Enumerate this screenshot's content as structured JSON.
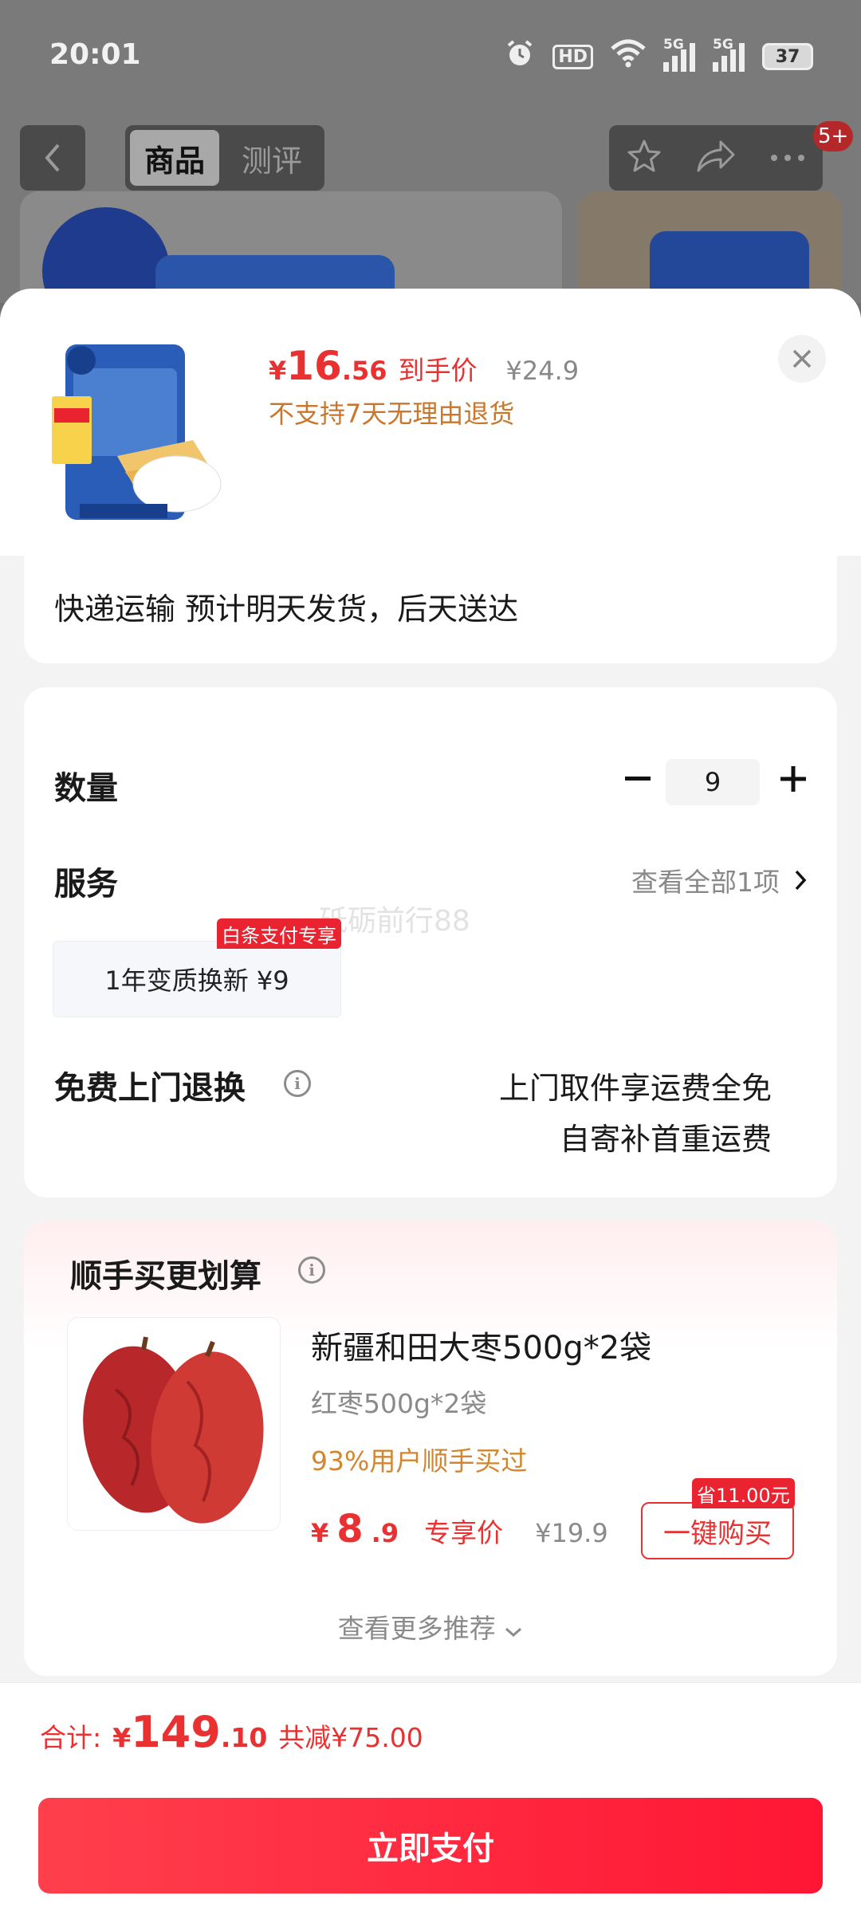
{
  "status_bar": {
    "time": "20:01",
    "hd_label": "HD",
    "signal_1": "5G",
    "signal_2": "5G",
    "battery": "37"
  },
  "nav": {
    "tabs": [
      "商品",
      "测评"
    ],
    "active_tab": "商品",
    "badge": "5+"
  },
  "product": {
    "price_currency": "¥",
    "price_int": "16",
    "price_dec": ".56",
    "price_tag": "到手价",
    "original_price": "¥24.9",
    "return_policy": "不支持7天无理由退货"
  },
  "shipping": {
    "text": "快递运输 预计明天发货，后天送达"
  },
  "options": {
    "quantity_label": "数量",
    "quantity_value": "9",
    "service_label": "服务",
    "service_link": "查看全部1项",
    "service_chip": "1年变质换新  ¥9",
    "service_badge": "白条支付专享",
    "watermark": "砥砺前行88",
    "return_label": "免费上门退换",
    "return_line1": "上门取件享运费全免",
    "return_line2": "自寄补首重运费"
  },
  "recommend": {
    "title": "顺手买更划算",
    "item_name": "新疆和田大枣500g*2袋",
    "item_spec": "红枣500g*2袋",
    "item_social": "93%用户顺手买过",
    "price_currency": "¥",
    "price_int": "8",
    "price_dec": ".9",
    "price_label": "专享价",
    "original_price": "¥19.9",
    "buy_button": "一键购买",
    "save_badge": "省11.00元",
    "more_link": "查看更多推荐"
  },
  "footer": {
    "total_label": "合计:",
    "total_currency": "¥",
    "total_int": "149",
    "total_dec": ".10",
    "total_save": "共减¥75.00",
    "pay_button": "立即支付"
  },
  "colors": {
    "accent_red": "#e93131",
    "orange_note": "#c9772c",
    "pay_gradient_start": "#ff3f4c",
    "pay_gradient_end": "#ff1634"
  }
}
